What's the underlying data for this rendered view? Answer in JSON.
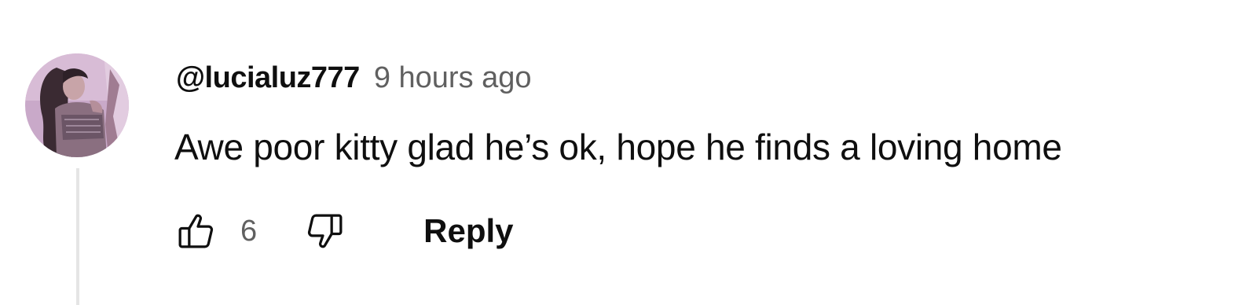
{
  "comment": {
    "author": "@lucialuz777",
    "timestamp": "9 hours ago",
    "text": "Awe poor kitty glad he’s ok, hope he finds a loving home",
    "like_count": "6",
    "reply_label": "Reply",
    "avatar_icon": "avatar-image",
    "like_icon": "thumbs-up-icon",
    "dislike_icon": "thumbs-down-icon"
  },
  "colors": {
    "text_primary": "#0f0f0f",
    "text_secondary": "#606060",
    "thread_line": "#e5e5e5"
  }
}
